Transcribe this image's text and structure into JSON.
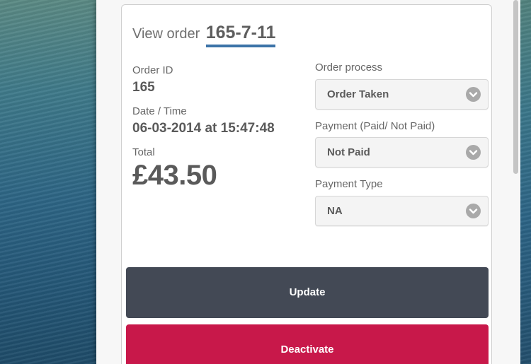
{
  "order": {
    "heading_prefix": "View order",
    "heading_number": "165-7-11",
    "id_label": "Order ID",
    "id_value": "165",
    "datetime_label": "Date / Time",
    "datetime_value": "06-03-2014 at 15:47:48",
    "total_label": "Total",
    "total_value": "£43.50"
  },
  "fields": {
    "process": {
      "label": "Order process",
      "value": "Order Taken"
    },
    "payment": {
      "label": "Payment (Paid/ Not Paid)",
      "value": "Not Paid"
    },
    "payment_type": {
      "label": "Payment Type",
      "value": "NA"
    }
  },
  "actions": {
    "update_label": "Update",
    "deactivate_label": "Deactivate"
  },
  "colors": {
    "accent_underline": "#3c73a8",
    "update_button": "#434955",
    "deactivate_button": "#c8184a"
  },
  "icons": {
    "dropdown": "chevron-down-icon"
  }
}
